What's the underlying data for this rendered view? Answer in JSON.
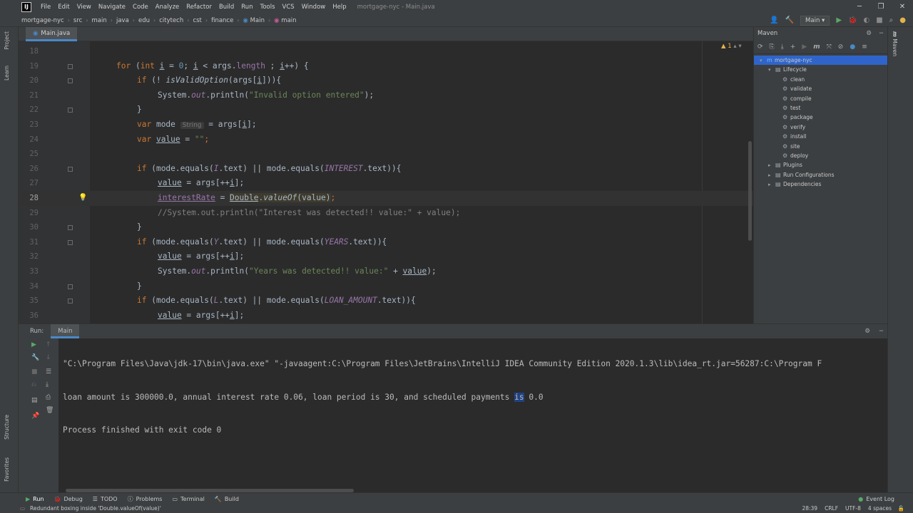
{
  "menu": {
    "items": [
      "File",
      "Edit",
      "View",
      "Navigate",
      "Code",
      "Analyze",
      "Refactor",
      "Build",
      "Run",
      "Tools",
      "VCS",
      "Window",
      "Help"
    ],
    "title": "mortgage-nyc - Main.java"
  },
  "breadcrumbs": [
    "mortgage-nyc",
    "src",
    "main",
    "java",
    "edu",
    "citytech",
    "cst",
    "finance",
    "Main",
    "main"
  ],
  "run_config": "Main",
  "left_tabs": {
    "project": "Project",
    "learn": "Learn",
    "structure": "Structure",
    "favorites": "Favorites"
  },
  "file_tab": "Main.java",
  "editor": {
    "warning_count": "1",
    "lines": [
      {
        "n": "18"
      },
      {
        "n": "19"
      },
      {
        "n": "20"
      },
      {
        "n": "21"
      },
      {
        "n": "22"
      },
      {
        "n": "23"
      },
      {
        "n": "24"
      },
      {
        "n": "25"
      },
      {
        "n": "26"
      },
      {
        "n": "27"
      },
      {
        "n": "28"
      },
      {
        "n": "29"
      },
      {
        "n": "30"
      },
      {
        "n": "31"
      },
      {
        "n": "32"
      },
      {
        "n": "33"
      },
      {
        "n": "34"
      },
      {
        "n": "35"
      },
      {
        "n": "36"
      }
    ],
    "code": {
      "l19_for": "for",
      "l19_a": " (",
      "l19_int": "int",
      "l19_b": " ",
      "l19_i": "i",
      "l19_c": " = ",
      "l19_zero": "0",
      "l19_d": "; ",
      "l19_e": "i",
      "l19_f": " < args.",
      "l19_len": "length",
      "l19_g": " ; ",
      "l19_h": "i",
      "l19_j": "++) {",
      "l20_if": "if",
      "l20_a": " (! ",
      "l20_m": "isValidOption",
      "l20_b": "(args[",
      "l20_i": "i",
      "l20_c": "])){",
      "l21_a": "System.",
      "l21_out": "out",
      "l21_b": ".println(",
      "l21_s": "\"Invalid option entered\"",
      "l21_c": ");",
      "l22": "}",
      "l23_var": "var",
      "l23_a": " mode ",
      "l23_hint": "String",
      "l23_b": " = args[",
      "l23_i": "i",
      "l23_c": "];",
      "l24_var": "var",
      "l24_a": " ",
      "l24_v": "value",
      "l24_b": " = ",
      "l24_s": "\"\"",
      "l24_c": ";",
      "l26_if": "if",
      "l26_a": " (mode.equals(",
      "l26_I": "I",
      "l26_b": ".text) || mode.equals(",
      "l26_INT": "INTEREST",
      "l26_c": ".text)){",
      "l27_v": "value",
      "l27_a": " = args[++",
      "l27_i": "i",
      "l27_b": "];",
      "l28_ir": "interestRate",
      "l28_a": " = ",
      "l28_d": "Double",
      "l28_b": ".",
      "l28_m": "valueOf",
      "l28_c": "(value)",
      "l28_e": ";",
      "l29": "//System.out.println(\"Interest was detected!! value:\" + value);",
      "l30": "}",
      "l31_if": "if",
      "l31_a": " (mode.equals(",
      "l31_Y": "Y",
      "l31_b": ".text) || mode.equals(",
      "l31_YRS": "YEARS",
      "l31_c": ".text)){",
      "l32_v": "value",
      "l32_a": " = args[++",
      "l32_i": "i",
      "l32_b": "];",
      "l33_a": "System.",
      "l33_out": "out",
      "l33_b": ".println(",
      "l33_s": "\"Years was detected!! value:\"",
      "l33_c": " + ",
      "l33_v": "value",
      "l33_d": ");",
      "l34": "}",
      "l35_if": "if",
      "l35_a": " (mode.equals(",
      "l35_L": "L",
      "l35_b": ".text) || mode.equals(",
      "l35_LA": "LOAN_AMOUNT",
      "l35_c": ".text)){",
      "l36_v": "value",
      "l36_a": " = args[++",
      "l36_i": "i",
      "l36_b": "];"
    }
  },
  "maven": {
    "title": "Maven",
    "tree": [
      {
        "label": "mortgage-nyc",
        "depth": 0,
        "toggle": "▾",
        "icon": "m",
        "selected": true
      },
      {
        "label": "Lifecycle",
        "depth": 1,
        "toggle": "▾",
        "icon": "▤",
        "selected": false
      },
      {
        "label": "clean",
        "depth": 2,
        "toggle": "",
        "icon": "⚙",
        "selected": false
      },
      {
        "label": "validate",
        "depth": 2,
        "toggle": "",
        "icon": "⚙",
        "selected": false
      },
      {
        "label": "compile",
        "depth": 2,
        "toggle": "",
        "icon": "⚙",
        "selected": false
      },
      {
        "label": "test",
        "depth": 2,
        "toggle": "",
        "icon": "⚙",
        "selected": false
      },
      {
        "label": "package",
        "depth": 2,
        "toggle": "",
        "icon": "⚙",
        "selected": false
      },
      {
        "label": "verify",
        "depth": 2,
        "toggle": "",
        "icon": "⚙",
        "selected": false
      },
      {
        "label": "install",
        "depth": 2,
        "toggle": "",
        "icon": "⚙",
        "selected": false
      },
      {
        "label": "site",
        "depth": 2,
        "toggle": "",
        "icon": "⚙",
        "selected": false
      },
      {
        "label": "deploy",
        "depth": 2,
        "toggle": "",
        "icon": "⚙",
        "selected": false
      },
      {
        "label": "Plugins",
        "depth": 1,
        "toggle": "▸",
        "icon": "▤",
        "selected": false
      },
      {
        "label": "Run Configurations",
        "depth": 1,
        "toggle": "▸",
        "icon": "▤",
        "selected": false
      },
      {
        "label": "Dependencies",
        "depth": 1,
        "toggle": "▸",
        "icon": "▤",
        "selected": false
      }
    ]
  },
  "right_tabs": {
    "maven": "Maven"
  },
  "run": {
    "label": "Run:",
    "tab": "Main",
    "console": {
      "line1": "\"C:\\Program Files\\Java\\jdk-17\\bin\\java.exe\" \"-javaagent:C:\\Program Files\\JetBrains\\IntelliJ IDEA Community Edition 2020.1.3\\lib\\idea_rt.jar=56287:C:\\Program F",
      "line2_a": "loan amount is 300000.0, annual interest rate 0.06, loan period is 30, and scheduled payments ",
      "line2_hit": "is",
      "line2_b": " 0.0",
      "line3": "Process finished with exit code 0"
    }
  },
  "toolwindows": [
    "Run",
    "Debug",
    "TODO",
    "Problems",
    "Terminal",
    "Build"
  ],
  "event_log": "Event Log",
  "status": {
    "message": "Redundant boxing inside 'Double.valueOf(value)'",
    "position": "28:39",
    "line_sep": "CRLF",
    "encoding": "UTF-8",
    "indent": "4 spaces"
  },
  "colors": {
    "accent": "#4a88c7",
    "selection": "#2f65ca",
    "keyword": "#cc7832",
    "string": "#6a8759",
    "number": "#6897bb",
    "field": "#9876aa"
  }
}
